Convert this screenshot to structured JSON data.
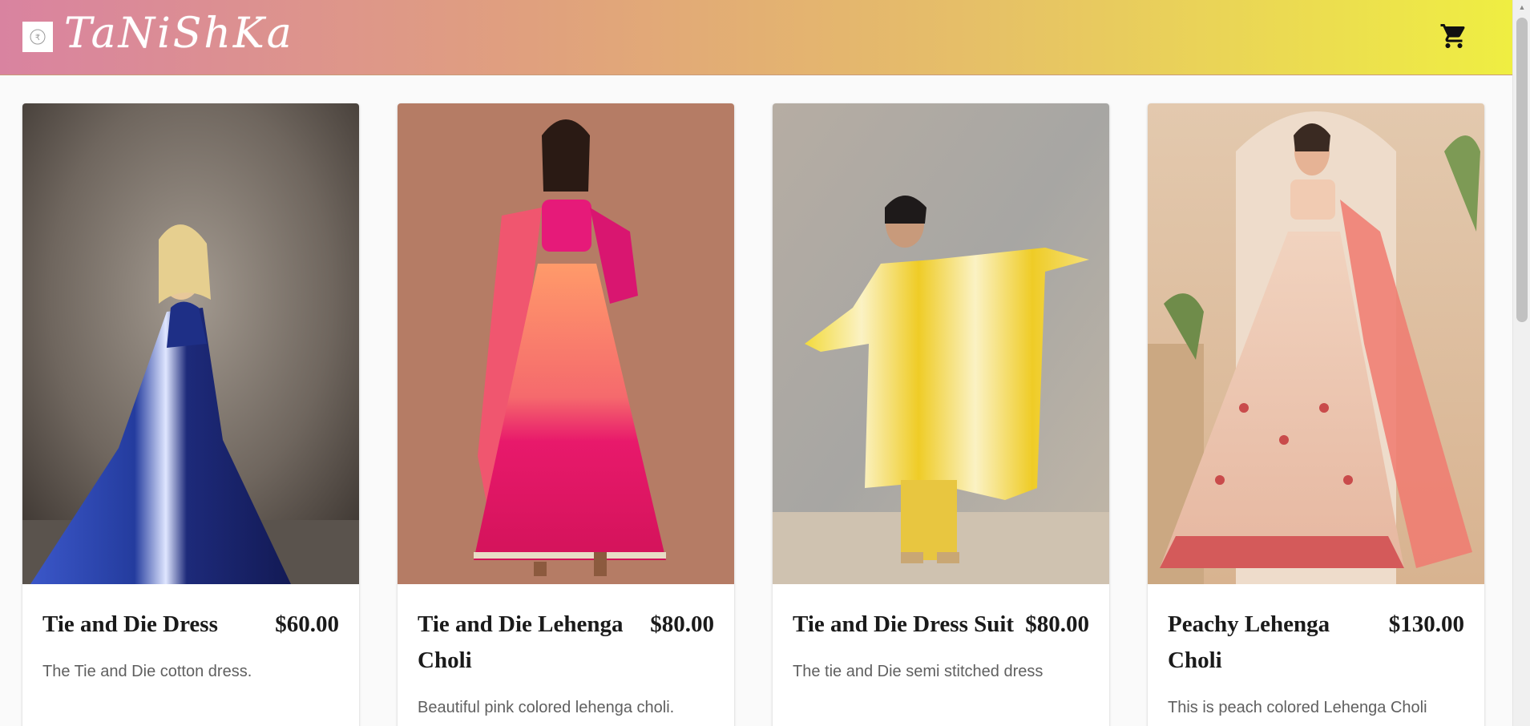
{
  "header": {
    "brand": "TaNiShKa",
    "logo_icon": "rupee-coin-icon",
    "cart_icon": "shopping-cart-icon"
  },
  "colors": {
    "header_gradient_start": "#d983a0",
    "header_gradient_end": "#efee42",
    "page_background": "#fafafa"
  },
  "products": [
    {
      "title": "Tie and Die Dress",
      "price": "$60.00",
      "description": "The Tie and Die cotton dress.",
      "image": "blue tie-dye maxi dress photo"
    },
    {
      "title": "Tie and Die Lehenga Choli",
      "price": "$80.00",
      "description": "Beautiful pink colored lehenga choli.",
      "image": "pink and orange lehenga choli photo"
    },
    {
      "title": "Tie and Die Dress Suit",
      "price": "$80.00",
      "description": "The tie and Die semi stitched dress",
      "image": "yellow tie-dye kaftan suit photo"
    },
    {
      "title": "Peachy Lehenga Choli",
      "price": "$130.00",
      "description": "This is peach colored Lehenga Choli",
      "image": "peach embroidered lehenga choli photo"
    }
  ]
}
